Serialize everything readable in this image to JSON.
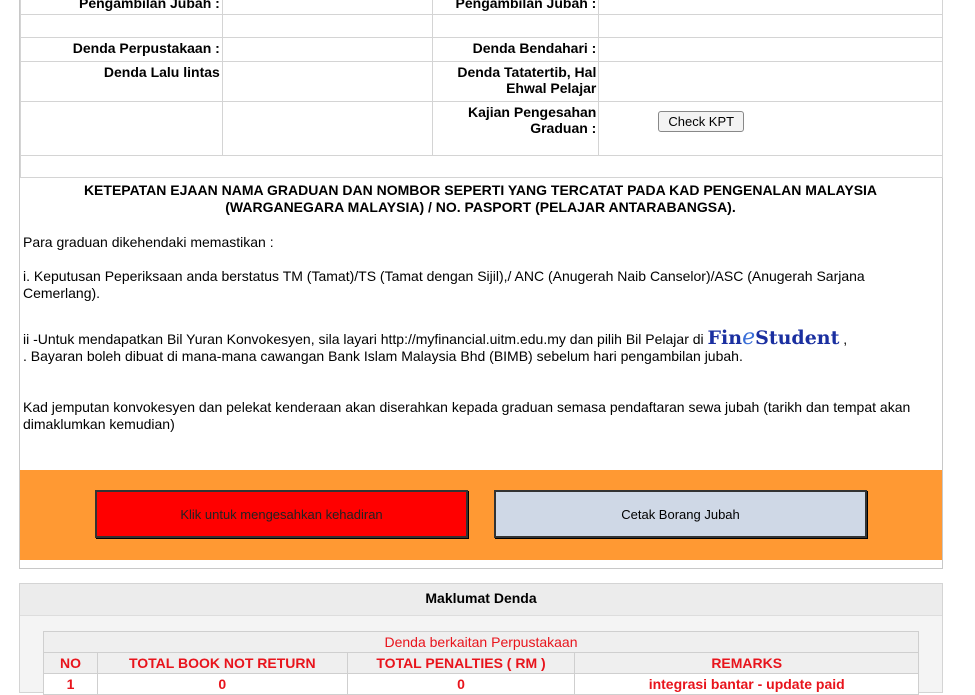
{
  "info_table": {
    "row1": {
      "left_label": "Pengambilan Jubah :",
      "right_label": "Pengambilan Jubah :"
    },
    "row3": {
      "left_label": "Denda Perpustakaan :",
      "right_label": "Denda Bendahari :"
    },
    "row4": {
      "left_label": "Denda Lalu lintas",
      "right_label": "Denda Tatatertib, Hal Ehwal Pelajar"
    },
    "row5": {
      "right_label": "Kajian Pengesahan Graduan :",
      "button_label": "Check KPT"
    }
  },
  "notice": {
    "heading": "KETEPATAN EJAAN NAMA GRADUAN DAN NOMBOR SEPERTI YANG TERCATAT PADA KAD PENGENALAN MALAYSIA (WARGANEGARA MALAYSIA) / NO. PASPORT (PELAJAR ANTARABANGSA).",
    "intro": "Para graduan dikehendaki memastikan :",
    "point1": "i. Keputusan Peperiksaan anda berstatus TM (Tamat)/TS (Tamat dengan Sijil),/ ANC (Anugerah Naib Canselor)/ASC (Anugerah Sarjana Cemerlang).",
    "point2_text": "ii -Untuk mendapatkan Bil Yuran Konvokesyen, sila layari http://myfinancial.uitm.edu.my dan pilih Bil Pelajar di",
    "point2_brand": {
      "part1": "Fin",
      "part2": "e",
      "part3": "Student"
    },
    "point2_comma": ",",
    "point2_line2": ". Bayaran boleh dibuat di mana-mana cawangan Bank Islam Malaysia Bhd (BIMB) sebelum hari pengambilan jubah.",
    "point3": "Kad jemputan konvokesyen dan pelekat kenderaan akan diserahkan kepada graduan semasa pendaftaran sewa jubah (tarikh dan tempat akan dimaklumkan kemudian)"
  },
  "actions": {
    "confirm_label": "Klik untuk mengesahkan kehadiran",
    "print_label": "Cetak Borang Jubah",
    "colors": {
      "band": "#ff9933",
      "confirm": "#ff0000",
      "print": "#cfd8e6"
    }
  },
  "denda": {
    "title": "Maklumat Denda",
    "caption": "Denda berkaitan Perpustakaan",
    "headers": [
      "NO",
      "TOTAL BOOK NOT RETURN",
      "TOTAL PENALTIES ( RM )",
      "REMARKS"
    ],
    "rows": [
      [
        "1",
        "0",
        "0",
        "integrasi bantar - update paid"
      ]
    ],
    "text_color": "#e8141c"
  }
}
